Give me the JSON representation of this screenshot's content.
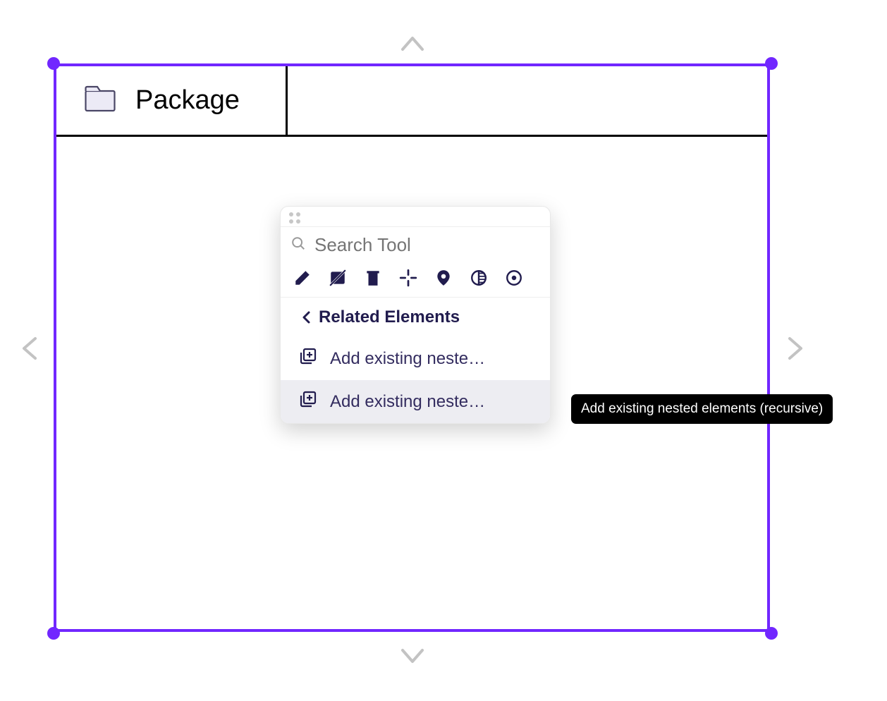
{
  "package": {
    "title": "Package"
  },
  "popup": {
    "search_placeholder": "Search Tool",
    "section_header": "Related Elements",
    "items": [
      {
        "label": "Add existing neste…"
      },
      {
        "label": "Add existing neste…"
      }
    ]
  },
  "tooltip": {
    "text": "Add existing nested elements (recursive)"
  }
}
